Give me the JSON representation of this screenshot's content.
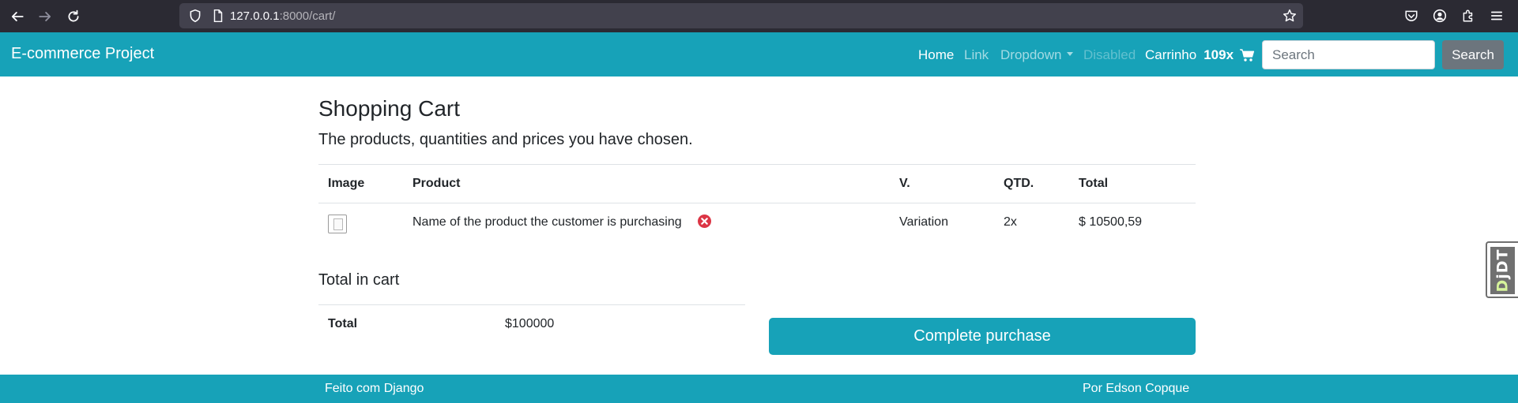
{
  "browser": {
    "url_host": "127.0.0.1",
    "url_rest": ":8000/cart/",
    "icons": [
      "back-arrow-icon",
      "forward-arrow-icon",
      "reload-icon",
      "shield-icon",
      "page-icon",
      "star-icon",
      "pocket-icon",
      "account-icon",
      "extensions-icon",
      "menu-icon"
    ]
  },
  "navbar": {
    "brand": "E-commerce Project",
    "links": {
      "home": "Home",
      "link": "Link",
      "dropdown": "Dropdown",
      "disabled": "Disabled"
    },
    "cart_label": "Carrinho",
    "cart_count": "109x",
    "search_placeholder": "Search",
    "search_button": "Search",
    "colors": {
      "primary": "#17a2b8",
      "secondary": "#6c757d"
    }
  },
  "main": {
    "title": "Shopping Cart",
    "lead": "The products, quantities and prices you have chosen.",
    "table": {
      "headers": {
        "image": "Image",
        "product": "Product",
        "variation": "V.",
        "quantity": "QTD.",
        "total": "Total"
      },
      "rows": [
        {
          "product": "Name of the product the customer is purchasing",
          "variation": "Variation",
          "quantity": "2x",
          "total": "$ 10500,59"
        }
      ]
    },
    "summary": {
      "heading": "Total in cart",
      "label": "Total",
      "value": "$100000"
    },
    "complete_button": "Complete purchase"
  },
  "footer": {
    "left": "Feito com Django",
    "right": "Por Edson Copque"
  },
  "debug_toolbar": {
    "label_d": "D",
    "label_rest": "jDT"
  }
}
